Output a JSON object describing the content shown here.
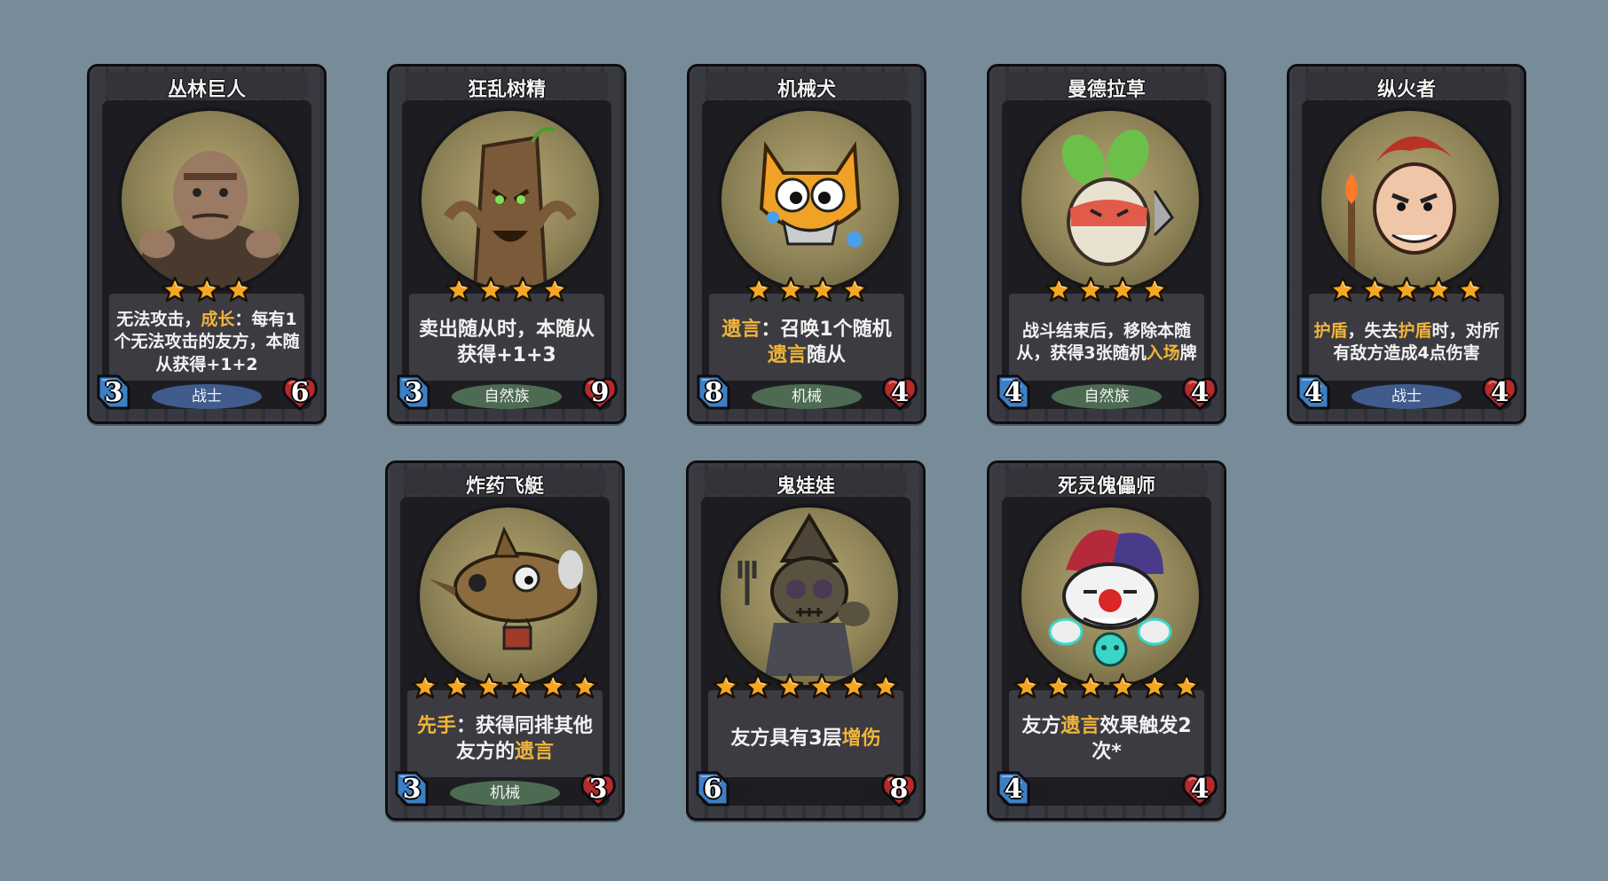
{
  "cards": [
    {
      "name": "丛林巨人",
      "stars": 3,
      "attack": "3",
      "health": "6",
      "tribe": "战士",
      "tribe_color": "#3f5c8c",
      "portrait": "jungle-giant",
      "text_size": "small",
      "desc": [
        {
          "t": "无法攻击，"
        },
        {
          "t": "成长",
          "kw": true
        },
        {
          "t": "：每有1个无法攻击的友方，本随从获得+1+2"
        }
      ]
    },
    {
      "name": "狂乱树精",
      "stars": 4,
      "attack": "3",
      "health": "9",
      "tribe": "自然族",
      "tribe_color": "#4d6b52",
      "portrait": "treant",
      "text_size": "large",
      "desc": [
        {
          "t": "卖出随从时，本随从获得+1+3"
        }
      ]
    },
    {
      "name": "机械犬",
      "stars": 4,
      "attack": "8",
      "health": "4",
      "tribe": "机械",
      "tribe_color": "#4d6b52",
      "portrait": "mech-dog",
      "text_size": "large",
      "desc": [
        {
          "t": "遗言",
          "kw": true
        },
        {
          "t": "：召唤1个随机"
        },
        {
          "t": "遗言",
          "kw": true
        },
        {
          "t": "随从"
        }
      ]
    },
    {
      "name": "曼德拉草",
      "stars": 4,
      "attack": "4",
      "health": "4",
      "tribe": "自然族",
      "tribe_color": "#4d6b52",
      "portrait": "mandrake",
      "text_size": "small",
      "desc": [
        {
          "t": "战斗结束后，移除本随从，获得3张随机"
        },
        {
          "t": "入场",
          "kw": true
        },
        {
          "t": "牌"
        }
      ]
    },
    {
      "name": "纵火者",
      "stars": 5,
      "attack": "4",
      "health": "4",
      "tribe": "战士",
      "tribe_color": "#3f5c8c",
      "portrait": "arsonist",
      "text_size": "small",
      "desc": [
        {
          "t": "护盾",
          "kw": true
        },
        {
          "t": "，失去"
        },
        {
          "t": "护盾",
          "kw": true
        },
        {
          "t": "时，对所有敌方造成4点伤害"
        }
      ]
    },
    {
      "name": "炸药飞艇",
      "stars": 6,
      "attack": "3",
      "health": "3",
      "tribe": "机械",
      "tribe_color": "#4d6b52",
      "portrait": "blimp",
      "text_size": "large",
      "desc": [
        {
          "t": "先手",
          "kw": true
        },
        {
          "t": "：获得同排其他友方的"
        },
        {
          "t": "遗言",
          "kw": true
        }
      ]
    },
    {
      "name": "鬼娃娃",
      "stars": 6,
      "attack": "6",
      "health": "8",
      "tribe": "",
      "tribe_color": "#1e1e22",
      "portrait": "voodoo-doll",
      "text_size": "large",
      "desc": [
        {
          "t": "友方具有3层"
        },
        {
          "t": "增伤",
          "kw": true
        }
      ]
    },
    {
      "name": "死灵傀儡师",
      "stars": 6,
      "attack": "4",
      "health": "4",
      "tribe": "",
      "tribe_color": "#1e1e22",
      "portrait": "necro-puppeteer",
      "text_size": "large",
      "desc": [
        {
          "t": "友方"
        },
        {
          "t": "遗言",
          "kw": true
        },
        {
          "t": "效果触发2次*"
        }
      ]
    }
  ],
  "colors": {
    "background": "#788b99",
    "keyword": "#f0b43a",
    "star": "#f5a623",
    "attack_gem": "#3d7fc4",
    "health_gem": "#b52a2a"
  }
}
